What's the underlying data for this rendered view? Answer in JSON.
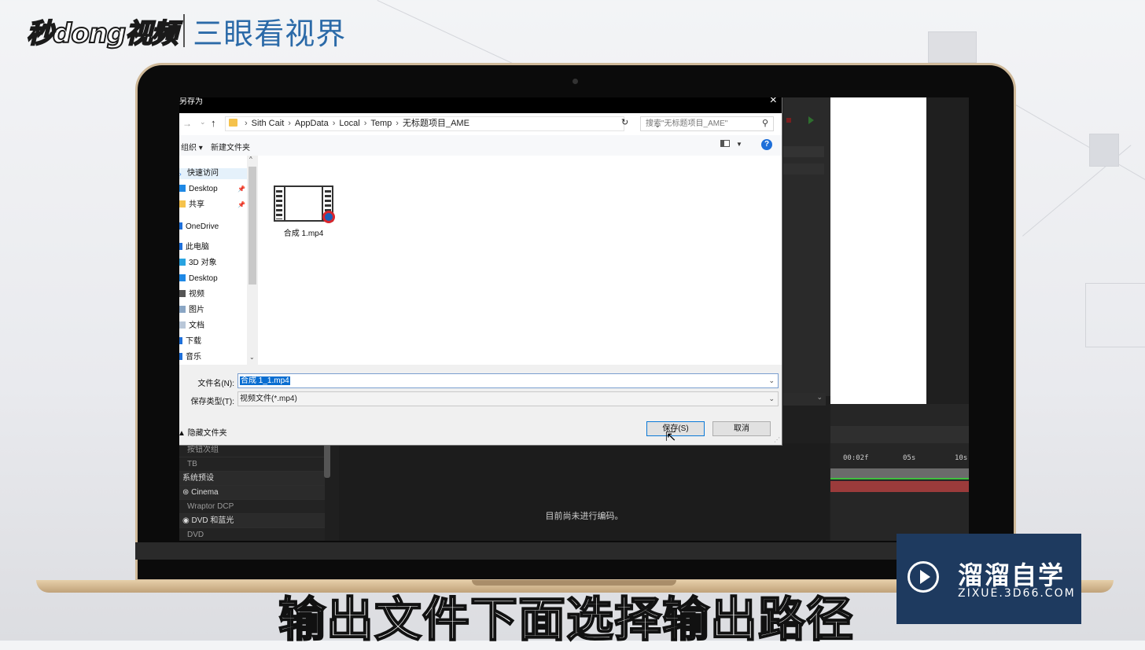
{
  "logo": {
    "brand": "秒dong视频",
    "show": "三眼看视界"
  },
  "dialog": {
    "title": "另存为",
    "close": "×",
    "nav": {
      "back": "→",
      "down": "⌄",
      "up": "↑"
    },
    "breadcrumbs": [
      "Sith Cait",
      "AppData",
      "Local",
      "Temp",
      "无标题项目_AME"
    ],
    "search_placeholder": "搜索\"无标题项目_AME\"",
    "toolbar": {
      "organize": "组织 ▾",
      "new_folder": "新建文件夹",
      "help": "?"
    },
    "nav_items": [
      {
        "label": "快速访问",
        "icon": "star-icon",
        "selected": true
      },
      {
        "label": "Desktop",
        "icon": "desktop-icon",
        "pinned": true
      },
      {
        "label": "共享",
        "icon": "folder-icon",
        "pinned": true
      },
      {
        "label": "OneDrive",
        "icon": "cloud-icon"
      },
      {
        "label": "此电脑",
        "icon": "computer-icon"
      },
      {
        "label": "3D 对象",
        "icon": "cube-icon"
      },
      {
        "label": "Desktop",
        "icon": "desktop-icon"
      },
      {
        "label": "视频",
        "icon": "video-icon"
      },
      {
        "label": "图片",
        "icon": "picture-icon"
      },
      {
        "label": "文档",
        "icon": "document-icon"
      },
      {
        "label": "下载",
        "icon": "download-icon"
      },
      {
        "label": "音乐",
        "icon": "music-icon"
      }
    ],
    "files": [
      {
        "name": "合成 1.mp4",
        "icon": "video-file-icon"
      }
    ],
    "filename_label": "文件名(N):",
    "filename_value": "合成 1_1.mp4",
    "filetype_label": "保存类型(T):",
    "filetype_value": "视频文件(*.mp4)",
    "hide_folders": "▲ 隐藏文件夹",
    "save_button": "保存(S)",
    "cancel_button": "取消"
  },
  "ame": {
    "left_rows": [
      {
        "label": "按钮次组",
        "kind": "sub"
      },
      {
        "label": "TB",
        "kind": "sub"
      },
      {
        "label": "系统预设",
        "kind": "head"
      },
      {
        "label": "⊛ Cinema",
        "kind": "head"
      },
      {
        "label": "Wraptor DCP",
        "kind": "sub"
      },
      {
        "label": "◉ DVD 和蓝光",
        "kind": "head"
      },
      {
        "label": "DVD",
        "kind": "sub"
      }
    ],
    "status_message": "目前尚未进行编码。",
    "timeline_ticks": [
      "00:02f",
      "05s",
      "10s"
    ]
  },
  "watermark": {
    "cn": "溜溜自学",
    "en": "ZIXUE.3D66.COM"
  },
  "subtitle": "输出文件下面选择输出路径"
}
